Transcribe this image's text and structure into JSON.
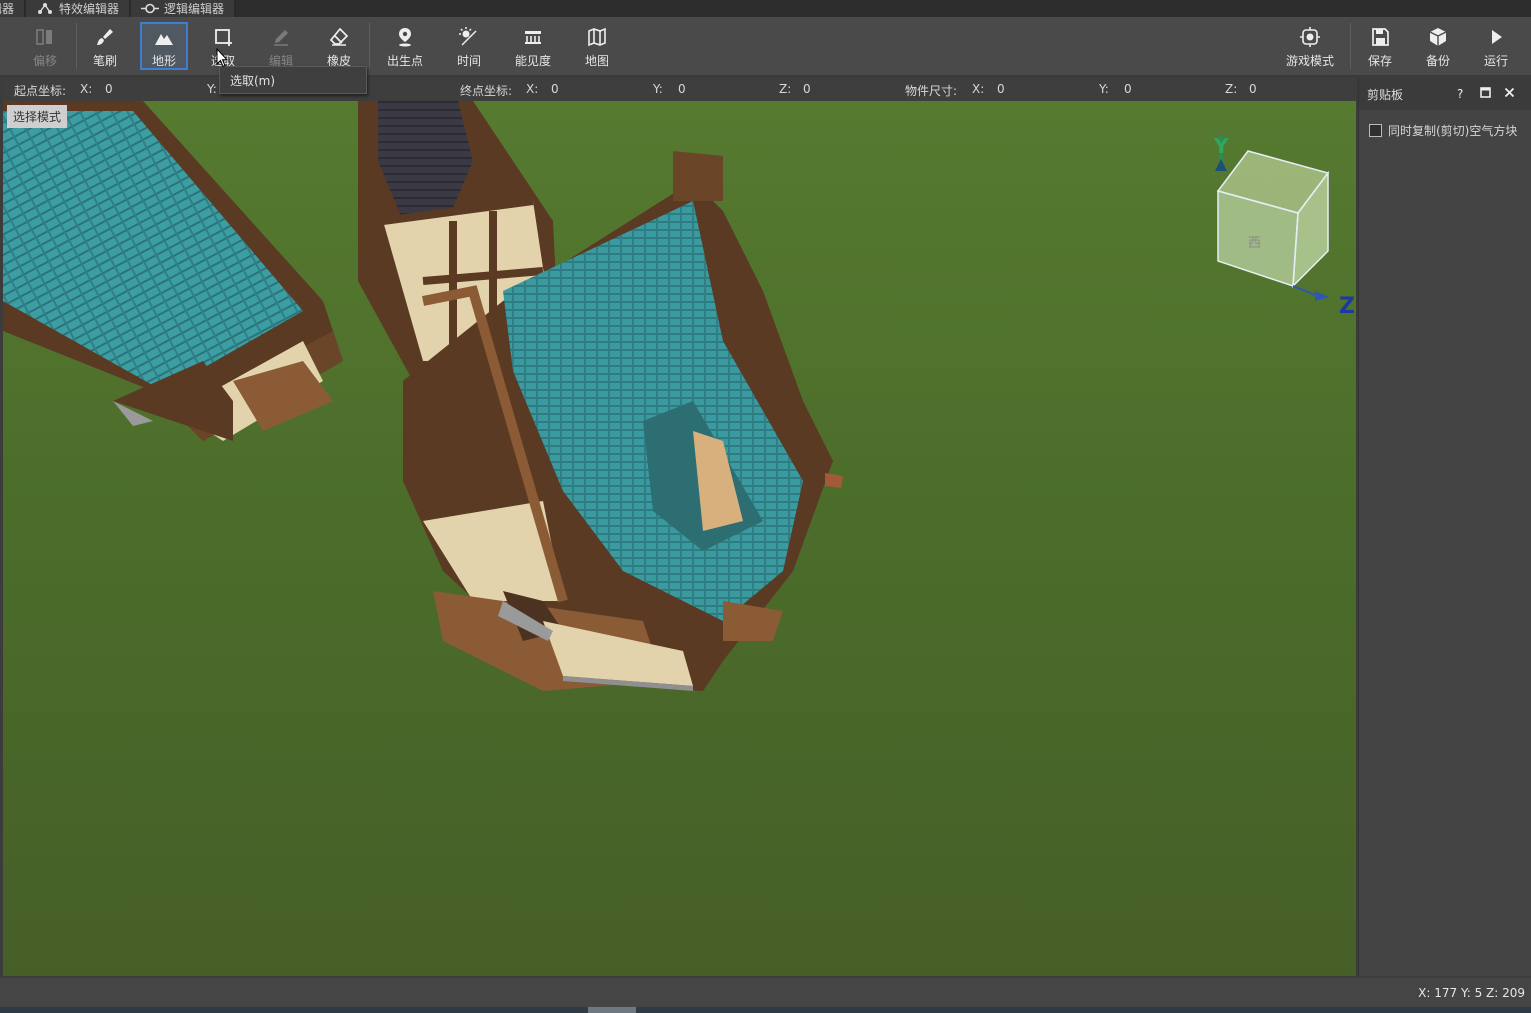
{
  "tabs": [
    {
      "label": "辑器",
      "icon": "none"
    },
    {
      "label": "特效编辑器",
      "icon": "particles-icon"
    },
    {
      "label": "逻辑编辑器",
      "icon": "logic-node-icon"
    }
  ],
  "toolbar": {
    "left_tools": [
      {
        "id": "offset",
        "label": "偏移",
        "icon": "offset-icon",
        "state": "disabled"
      },
      {
        "id": "brush",
        "label": "笔刷",
        "icon": "brush-icon",
        "state": "normal"
      },
      {
        "id": "terrain",
        "label": "地形",
        "icon": "mountain-icon",
        "state": "active"
      },
      {
        "id": "select",
        "label": "选取",
        "icon": "select-rect-icon",
        "state": "hover"
      },
      {
        "id": "edit",
        "label": "编辑",
        "icon": "pencil-icon",
        "state": "disabled"
      },
      {
        "id": "eraser",
        "label": "橡皮",
        "icon": "eraser-icon",
        "state": "normal"
      },
      {
        "id": "spawn",
        "label": "出生点",
        "icon": "location-pin-icon",
        "state": "normal"
      },
      {
        "id": "time",
        "label": "时间",
        "icon": "sun-moon-icon",
        "state": "normal"
      },
      {
        "id": "visibility",
        "label": "能见度",
        "icon": "visibility-icon",
        "state": "normal"
      },
      {
        "id": "map",
        "label": "地图",
        "icon": "map-icon",
        "state": "normal"
      }
    ],
    "right_tools": [
      {
        "id": "game-mode",
        "label": "游戏模式",
        "icon": "gamepad-icon"
      },
      {
        "id": "save",
        "label": "保存",
        "icon": "floppy-icon"
      },
      {
        "id": "backup",
        "label": "备份",
        "icon": "cube-icon"
      },
      {
        "id": "run",
        "label": "运行",
        "icon": "play-icon"
      }
    ]
  },
  "tooltip": {
    "text": "选取(m)"
  },
  "coords": {
    "start_label": "起点坐标:",
    "start": {
      "x_label": "X:",
      "x": "0",
      "y_label": "Y:"
    },
    "end_label": "终点坐标:",
    "end": {
      "x_label": "X:",
      "x": "0",
      "y_label": "Y:",
      "y": "0",
      "z_label": "Z:",
      "z": "0"
    },
    "size_label": "物件尺寸:",
    "size": {
      "x_label": "X:",
      "x": "0",
      "y_label": "Y:",
      "y": "0",
      "z_label": "Z:",
      "z": "0"
    }
  },
  "viewport": {
    "mode_badge": "选择模式",
    "axis_y": "Y",
    "axis_z": "Z",
    "cube_face": "西",
    "colors": {
      "grass": "#4e6f2c",
      "roof": "#3a9aa0",
      "wood": "#5a3a22"
    }
  },
  "clipboard_panel": {
    "title": "剪贴板",
    "help": "?",
    "copy_air_label": "同时复制(剪切)空气方块",
    "copy_air_checked": false
  },
  "status": {
    "coords": "X: 177  Y: 5  Z: 209"
  },
  "colors": {
    "accent": "#3f7ecf",
    "toolbar": "#4a4a4a",
    "panel": "#444444"
  }
}
